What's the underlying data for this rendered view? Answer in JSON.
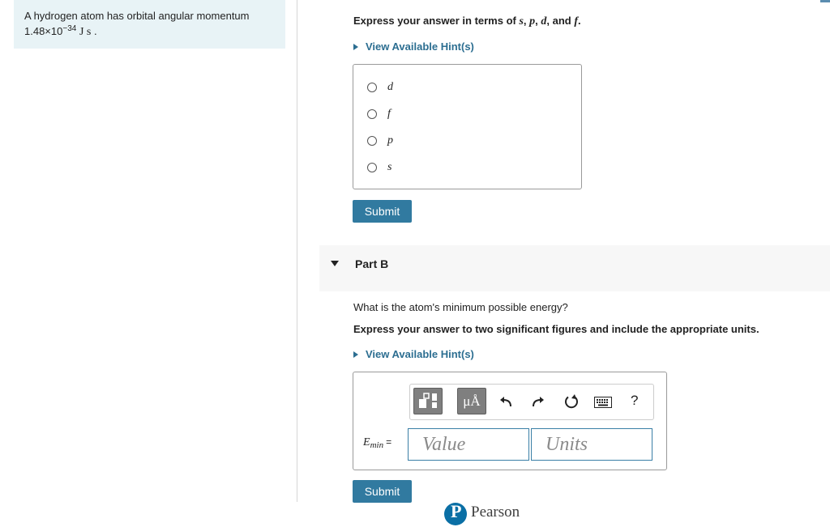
{
  "problem": {
    "text": "A hydrogen atom has orbital angular momentum",
    "value_base": "1.48×10",
    "value_exp": "−34",
    "value_units": "J s"
  },
  "partA": {
    "instruction": {
      "prefix": "Express your answer in terms of ",
      "s": "s",
      "p": "p",
      "d": "d",
      "and": ", and ",
      "f": "f",
      "suffix": "."
    },
    "hint_label": "View Available Hint(s)",
    "choices": [
      "d",
      "f",
      "p",
      "s"
    ],
    "submit_label": "Submit"
  },
  "partB": {
    "title": "Part B",
    "question": "What is the atom's minimum possible energy?",
    "instruction": "Express your answer to two significant figures and include the appropriate units.",
    "hint_label": "View Available Hint(s)",
    "toolbar": {
      "mu_label": "μÅ",
      "help_label": "?",
      "icons": [
        "templates-icon",
        "units-icon",
        "undo-icon",
        "redo-icon",
        "reset-icon",
        "keyboard-icon",
        "help-icon"
      ]
    },
    "lhs_var": "E",
    "lhs_sub": "min",
    "lhs_eq": "=",
    "value_placeholder": "Value",
    "units_placeholder": "Units",
    "submit_label": "Submit"
  },
  "footer": {
    "brand": "Pearson",
    "brand_initial": "P"
  },
  "colors": {
    "accent": "#317aa0",
    "link": "#2c6e91",
    "problem_bg": "#e8f3f6",
    "field_border": "#3a7fa6",
    "toolbar_button": "#7f7f7f"
  }
}
